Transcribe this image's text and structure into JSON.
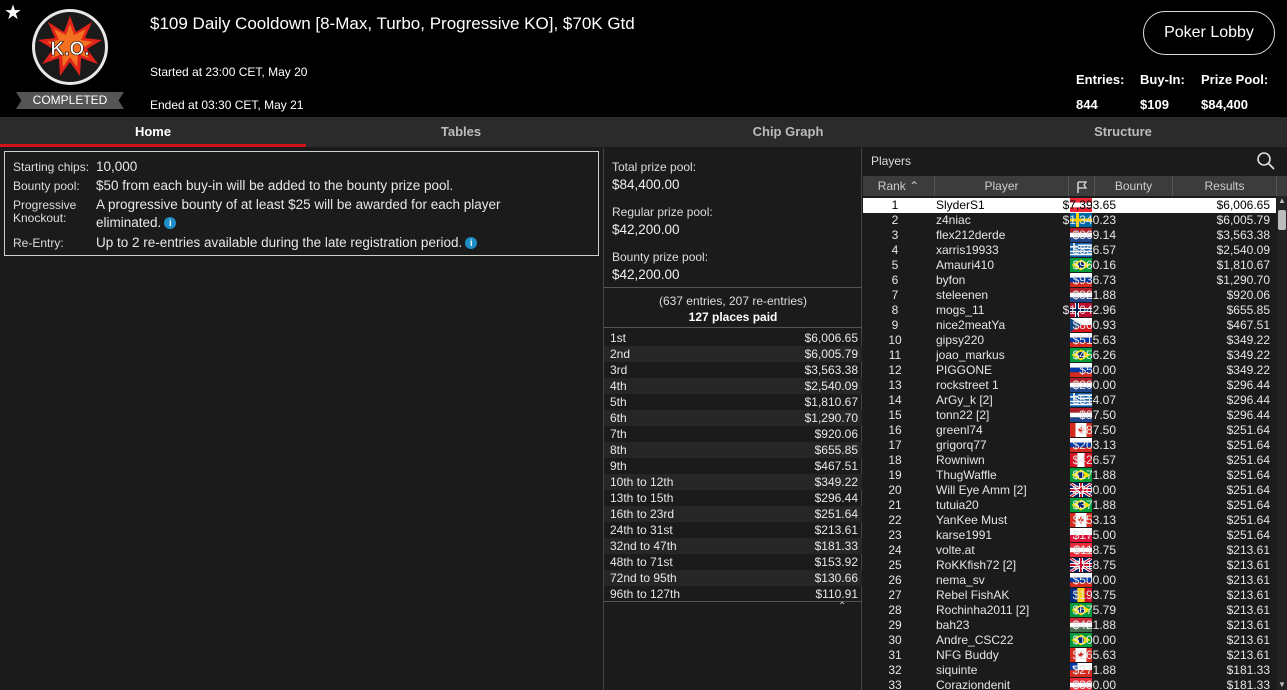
{
  "header": {
    "title": "$109 Daily Cooldown [8-Max, Turbo, Progressive KO], $70K Gtd",
    "status_badge": "COMPLETED",
    "logo_text": "K.O.",
    "started": "Started at 23:00 CET, May 20",
    "ended": "Ended at 03:30 CET, May 21",
    "lobby_button": "Poker Lobby",
    "entries_label": "Entries:",
    "entries_value": "844",
    "buyin_label": "Buy-In:",
    "buyin_value": "$109",
    "prizepool_label": "Prize Pool:",
    "prizepool_value": "$84,400"
  },
  "tabs": [
    {
      "label": "Home",
      "active": true
    },
    {
      "label": "Tables"
    },
    {
      "label": "Chip Graph"
    },
    {
      "label": "Structure"
    }
  ],
  "info": {
    "starting_chips_label": "Starting chips:",
    "starting_chips_value": "10,000",
    "bounty_pool_label": "Bounty pool:",
    "bounty_pool_value": "$50 from each buy-in will be added to the bounty prize pool.",
    "pko_label": "Progressive Knockout:",
    "pko_value": "A progressive bounty of at least $25 will be awarded for each player eliminated.",
    "reentry_label": "Re-Entry:",
    "reentry_value": "Up to 2 re-entries available during the late registration period."
  },
  "pools": {
    "total_label": "Total prize pool:",
    "total_value": "$84,400.00",
    "regular_label": "Regular prize pool:",
    "regular_value": "$42,200.00",
    "bounty_label": "Bounty prize pool:",
    "bounty_value": "$42,200.00",
    "entries_note": "(637 entries, 207 re-entries)",
    "places_paid": "127 places paid"
  },
  "payouts": [
    {
      "place": "1st",
      "amount": "$6,006.65"
    },
    {
      "place": "2nd",
      "amount": "$6,005.79"
    },
    {
      "place": "3rd",
      "amount": "$3,563.38"
    },
    {
      "place": "4th",
      "amount": "$2,540.09"
    },
    {
      "place": "5th",
      "amount": "$1,810.67"
    },
    {
      "place": "6th",
      "amount": "$1,290.70"
    },
    {
      "place": "7th",
      "amount": "$920.06"
    },
    {
      "place": "8th",
      "amount": "$655.85"
    },
    {
      "place": "9th",
      "amount": "$467.51"
    },
    {
      "place": "10th to 12th",
      "amount": "$349.22"
    },
    {
      "place": "13th to 15th",
      "amount": "$296.44"
    },
    {
      "place": "16th to 23rd",
      "amount": "$251.64"
    },
    {
      "place": "24th to 31st",
      "amount": "$213.61"
    },
    {
      "place": "32nd to 47th",
      "amount": "$181.33"
    },
    {
      "place": "48th to 71st",
      "amount": "$153.92"
    },
    {
      "place": "72nd to 95th",
      "amount": "$130.66"
    },
    {
      "place": "96th to 127th",
      "amount": "$110.91"
    }
  ],
  "players_panel": {
    "title": "Players",
    "col_rank": "Rank",
    "col_player": "Player",
    "col_bounty": "Bounty",
    "col_results": "Results"
  },
  "players": [
    {
      "rank": "1",
      "name": "SlyderS1",
      "flag": "AT",
      "bounty": "$7,393.65",
      "result": "$6,006.65"
    },
    {
      "rank": "2",
      "name": "z4niac",
      "flag": "SE",
      "bounty": "$1,340.23",
      "result": "$6,005.79"
    },
    {
      "rank": "3",
      "name": "flex212derde",
      "flag": "NL",
      "bounty": "$869.14",
      "result": "$3,563.38"
    },
    {
      "rank": "4",
      "name": "xarris19933",
      "flag": "GR",
      "bounty": "$826.57",
      "result": "$2,540.09"
    },
    {
      "rank": "5",
      "name": "Amauri410",
      "flag": "BR",
      "bounty": "$960.16",
      "result": "$1,810.67"
    },
    {
      "rank": "6",
      "name": "byfon",
      "flag": "RU",
      "bounty": "$936.73",
      "result": "$1,290.70"
    },
    {
      "rank": "7",
      "name": "steleenen",
      "flag": "NL",
      "bounty": "$321.88",
      "result": "$920.06"
    },
    {
      "rank": "8",
      "name": "mogs_11",
      "flag": "NO",
      "bounty": "$1,042.96",
      "result": "$655.85"
    },
    {
      "rank": "9",
      "name": "nice2meatYa",
      "flag": "CZ",
      "bounty": "$860.93",
      "result": "$467.51"
    },
    {
      "rank": "10",
      "name": "gipsy220",
      "flag": "RU",
      "bounty": "$515.63",
      "result": "$349.22"
    },
    {
      "rank": "11",
      "name": "joao_markus",
      "flag": "BR",
      "bounty": "$456.26",
      "result": "$349.22"
    },
    {
      "rank": "12",
      "name": "PIGGONE",
      "flag": "RU",
      "bounty": "$50.00",
      "result": "$349.22"
    },
    {
      "rank": "13",
      "name": "rockstreet 1",
      "flag": "NL",
      "bounty": "$200.00",
      "result": "$296.44"
    },
    {
      "rank": "14",
      "name": "ArGy_k [2]",
      "flag": "GR",
      "bounty": "$514.07",
      "result": "$296.44"
    },
    {
      "rank": "15",
      "name": "tonn22 [2]",
      "flag": "NL",
      "bounty": "$87.50",
      "result": "$296.44"
    },
    {
      "rank": "16",
      "name": "greenl74",
      "flag": "CA",
      "bounty": "$87.50",
      "result": "$251.64"
    },
    {
      "rank": "17",
      "name": "grigorq77",
      "flag": "RU",
      "bounty": "$203.13",
      "result": "$251.64"
    },
    {
      "rank": "18",
      "name": "Rowniwn",
      "flag": "PE",
      "bounty": "$426.57",
      "result": "$251.64"
    },
    {
      "rank": "19",
      "name": "ThugWaffle",
      "flag": "BR",
      "bounty": "$171.88",
      "result": "$251.64"
    },
    {
      "rank": "20",
      "name": "Will Eye Amm [2]",
      "flag": "GB",
      "bounty": "$200.00",
      "result": "$251.64"
    },
    {
      "rank": "21",
      "name": "tutuia20",
      "flag": "BR",
      "bounty": "$371.88",
      "result": "$251.64"
    },
    {
      "rank": "22",
      "name": "YanKee Must",
      "flag": "CA",
      "bounty": "$453.13",
      "result": "$251.64"
    },
    {
      "rank": "23",
      "name": "karse1991",
      "flag": "PL",
      "bounty": "$175.00",
      "result": "$251.64"
    },
    {
      "rank": "24",
      "name": "volte.at",
      "flag": "AT",
      "bounty": "$118.75",
      "result": "$213.61"
    },
    {
      "rank": "25",
      "name": "RoKKfish72 [2]",
      "flag": "GB",
      "bounty": "$118.75",
      "result": "$213.61"
    },
    {
      "rank": "26",
      "name": "nema_sv",
      "flag": "RU",
      "bounty": "$500.00",
      "result": "$213.61"
    },
    {
      "rank": "27",
      "name": "Rebel FishAK",
      "flag": "RO",
      "bounty": "$193.75",
      "result": "$213.61"
    },
    {
      "rank": "28",
      "name": "Rochinha2011 [2]",
      "flag": "BR",
      "bounty": "$675.79",
      "result": "$213.61"
    },
    {
      "rank": "29",
      "name": "bah23",
      "flag": "HU",
      "bounty": "$421.88",
      "result": "$213.61"
    },
    {
      "rank": "30",
      "name": "Andre_CSC22",
      "flag": "BR",
      "bounty": "$100.00",
      "result": "$213.61"
    },
    {
      "rank": "31",
      "name": "NFG Buddy",
      "flag": "CA",
      "bounty": "$265.63",
      "result": "$213.61"
    },
    {
      "rank": "32",
      "name": "siquinte",
      "flag": "CL",
      "bounty": "$271.88",
      "result": "$181.33"
    },
    {
      "rank": "33",
      "name": "Coraziondenit",
      "flag": "AT",
      "bounty": "$300.00",
      "result": "$181.33"
    }
  ],
  "colors": {
    "accent_red": "#d0121b",
    "info_blue": "#1f8ec6"
  }
}
